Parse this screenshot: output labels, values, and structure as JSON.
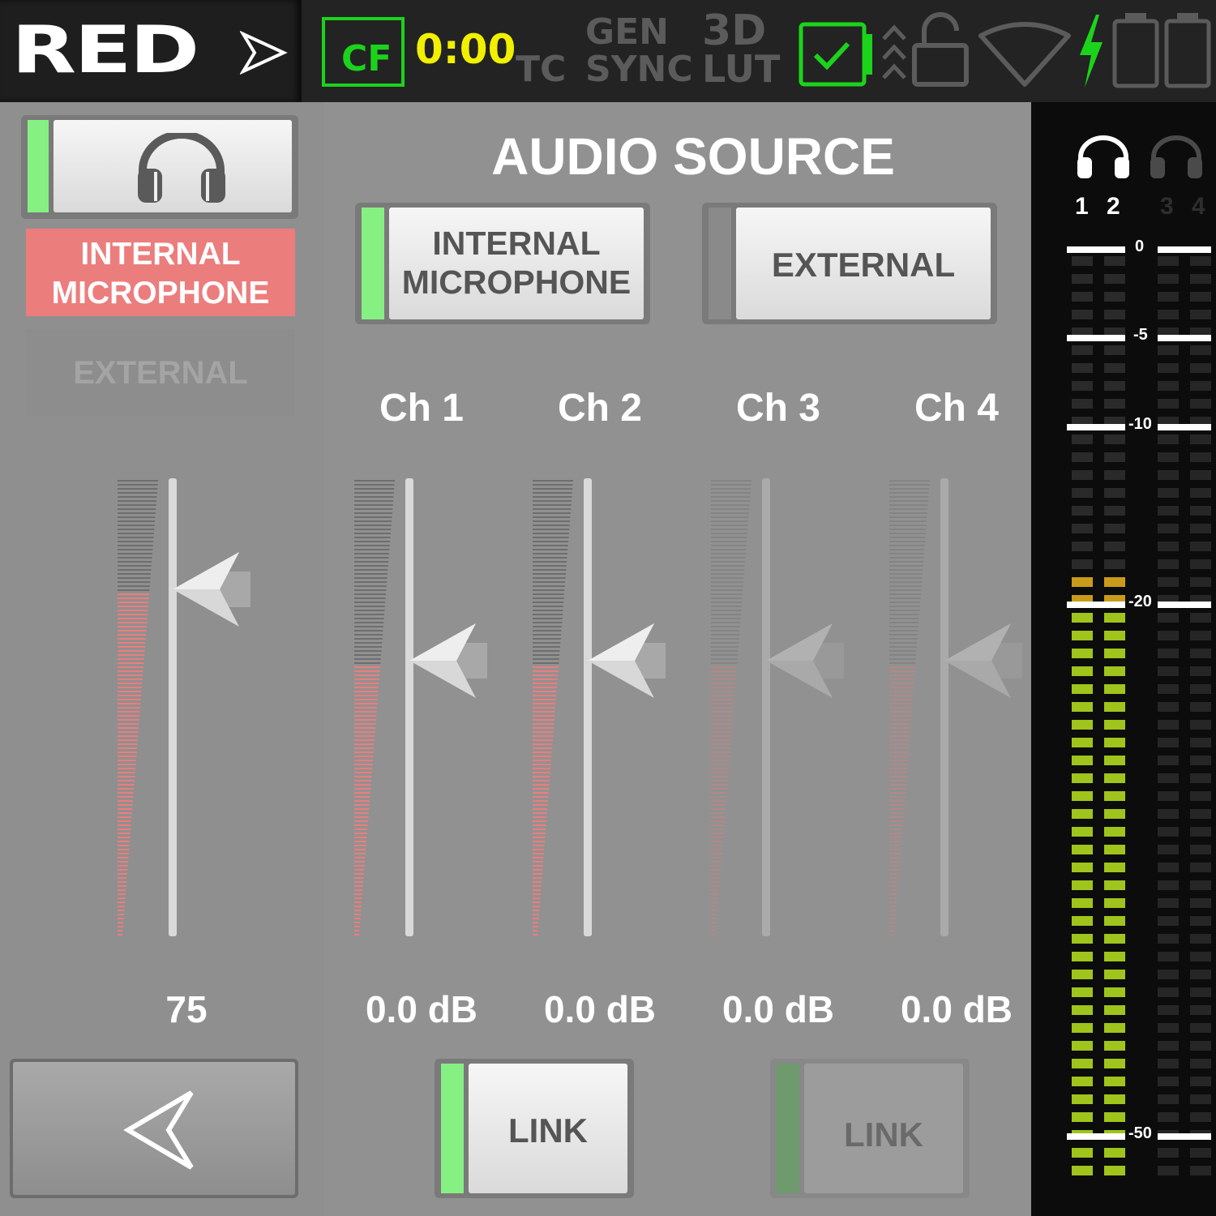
{
  "statusbar": {
    "brand": "RED",
    "media": "CF",
    "time": "0:00",
    "tc": "TC",
    "gen": "GEN",
    "sync": "SYNC",
    "lut_top": "3D",
    "lut_bottom": "LUT"
  },
  "left": {
    "source_active": "INTERNAL\nMICROPHONE",
    "source_other": "EXTERNAL",
    "volume": "75"
  },
  "main": {
    "title": "AUDIO SOURCE",
    "internal_button": "INTERNAL\nMICROPHONE",
    "external_button": "EXTERNAL",
    "channels": [
      {
        "label": "Ch 1",
        "gain": "0.0 dB"
      },
      {
        "label": "Ch 2",
        "gain": "0.0 dB"
      },
      {
        "label": "Ch 3",
        "gain": "0.0 dB"
      },
      {
        "label": "Ch 4",
        "gain": "0.0 dB"
      }
    ],
    "link1": "LINK",
    "link2": "LINK"
  },
  "meters": {
    "channel_labels": [
      "1",
      "2",
      "3",
      "4"
    ],
    "scale": [
      "0",
      "-5",
      "-10",
      "-20",
      "-50"
    ]
  },
  "colors": {
    "accent_green": "#1bd31b",
    "time_yellow": "#f0f000",
    "active_red": "#ec7d7d",
    "meter_green": "#9fc41b",
    "meter_amber": "#c99b1a"
  }
}
